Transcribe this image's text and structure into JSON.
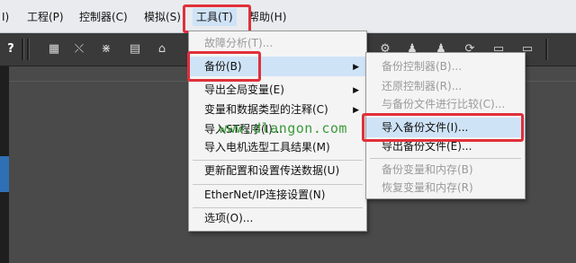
{
  "menubar": {
    "items": [
      "I)",
      "工程(P)",
      "控制器(C)",
      "模拟(S)",
      "工具(T)",
      "帮助(H)"
    ]
  },
  "toolbar": {
    "left_icon": "?",
    "icons": [
      "window-icon",
      "pointer-icon",
      "network-icon",
      "chart-icon",
      "tool-icon"
    ],
    "right_icons": [
      "gear-icon",
      "person-icon",
      "person-icon",
      "reload-icon",
      "monitor-icon",
      "monitor-icon"
    ]
  },
  "tools_menu": {
    "items": [
      {
        "label": "故障分析(T)...",
        "disabled": true
      },
      {
        "label": "备份(B)",
        "submenu": true,
        "highlighted": true
      },
      {
        "label": "导出全局变量(E)",
        "submenu": true
      },
      {
        "label": "变量和数据类型的注释(C)",
        "submenu": true
      },
      {
        "label": "导入ST程序(I)..."
      },
      {
        "label": "导入电机选型工具结果(M)"
      },
      {
        "label": "更新配置和设置传送数据(U)"
      },
      {
        "label": "EtherNet/IP连接设置(N)"
      },
      {
        "label": "选项(O)..."
      }
    ]
  },
  "backup_submenu": {
    "items": [
      {
        "label": "备份控制器(B)...",
        "disabled": true
      },
      {
        "label": "还原控制器(R)...",
        "disabled": true
      },
      {
        "label": "与备份文件进行比较(C)...",
        "disabled": true
      },
      {
        "label": "导入备份文件(I)...",
        "highlighted": true
      },
      {
        "label": "导出备份文件(E)..."
      },
      {
        "label": "备份变量和内存(B)",
        "disabled": true
      },
      {
        "label": "恢复变量和内存(R)",
        "disabled": true
      }
    ]
  },
  "watermark": "www.dlangon.com",
  "colors": {
    "highlight_box": "#e0303b",
    "hover": "#cfe3f7",
    "watermark": "#3c9a3c"
  }
}
